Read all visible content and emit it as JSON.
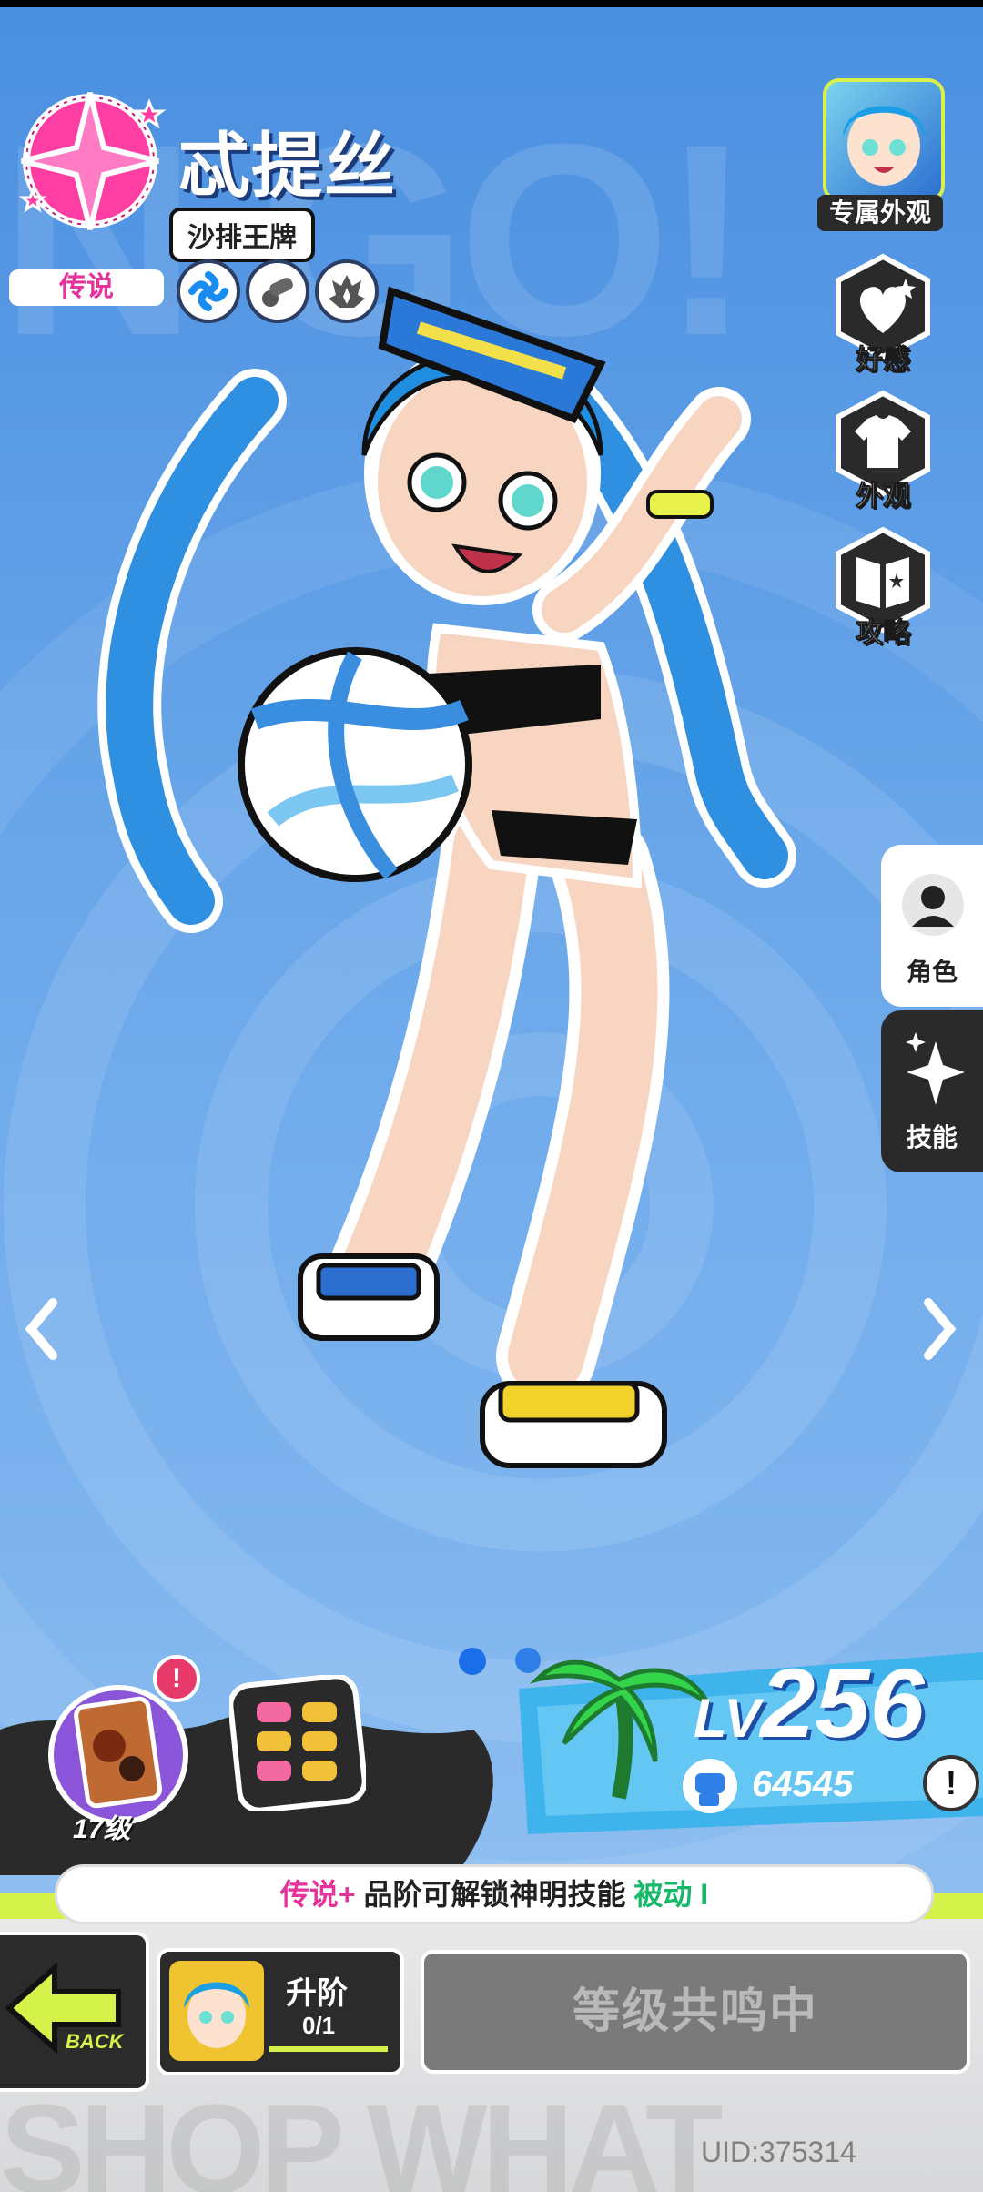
{
  "character": {
    "name": "忒提丝",
    "title": "沙排王牌",
    "rarity": "传说"
  },
  "side_menu": {
    "skin_label": "专属外观",
    "affinity": "好感",
    "appearance": "外观",
    "guide": "攻略"
  },
  "tabs": {
    "role": "角色",
    "skills": "技能"
  },
  "stats": {
    "level_prefix": "LV",
    "level": "256",
    "power": "64545"
  },
  "relic": {
    "level": "17级",
    "notice": "!"
  },
  "hint": {
    "part1": "传说+",
    "part2": " 品阶可解锁神明技能 ",
    "part3": "被动 I"
  },
  "buttons": {
    "back": "BACK",
    "ascend": "升阶",
    "ascend_progress": "0/1",
    "resonate": "等级共鸣中",
    "info": "!"
  },
  "uid": "UID:375314",
  "colors": {
    "accent_pink": "#e4339b",
    "accent_yellow": "#d5f24a",
    "bg_blue": "#5b9be3"
  },
  "icons": [
    "star-emblem-icon",
    "wind-element-icon",
    "cannon-icon",
    "flame-icon",
    "heart-star-icon",
    "shirt-icon",
    "book-icon",
    "person-icon",
    "sparkle-icon",
    "chevron-left-icon",
    "chevron-right-icon",
    "fist-icon",
    "palm-tree-icon",
    "grid-icon",
    "back-arrow-icon"
  ]
}
